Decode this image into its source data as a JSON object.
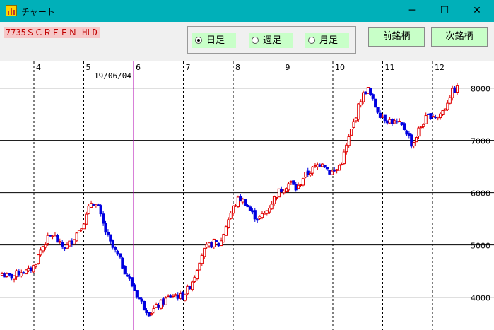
{
  "window": {
    "title": "チャート",
    "minimize": "─",
    "maximize": "☐",
    "close": "✕"
  },
  "stock": {
    "label": "7735ＳＣＲＥＥＮ HLD"
  },
  "period": {
    "options": [
      {
        "label": "日足",
        "selected": true
      },
      {
        "label": "週足",
        "selected": false
      },
      {
        "label": "月足",
        "selected": false
      }
    ]
  },
  "buttons": {
    "prev": "前銘柄",
    "next": "次銘柄"
  },
  "colors": {
    "titlebar": "#00b0b9",
    "up": "#e00000",
    "down": "#0000e0",
    "cursor": "#b000b0",
    "green_button": "#c8ffc8"
  },
  "chart_data": {
    "type": "candlestick",
    "y_ticks": [
      4000,
      5000,
      6000,
      7000,
      8000
    ],
    "y_tick_labels": [
      "4000",
      "5000",
      "6000",
      "7000",
      "8000"
    ],
    "x_month_labels": [
      "4",
      "5",
      "6",
      "7",
      "8",
      "9",
      "10",
      "11",
      "12"
    ],
    "cursor_date_label": "19/06/04",
    "ylim": [
      3400,
      8400
    ],
    "close_path": [
      4450,
      4380,
      4420,
      4500,
      4480,
      4600,
      4900,
      5100,
      5200,
      5000,
      4950,
      5100,
      5300,
      5500,
      5850,
      5700,
      5300,
      5000,
      4800,
      4550,
      4300,
      4050,
      3850,
      3700,
      3800,
      3900,
      4000,
      4050,
      4000,
      4150,
      4400,
      4800,
      4950,
      5050,
      5000,
      5400,
      5700,
      5900,
      5800,
      5600,
      5500,
      5600,
      5800,
      6000,
      6100,
      6200,
      6050,
      6300,
      6400,
      6500,
      6600,
      6400,
      6400,
      6600,
      7000,
      7400,
      7800,
      8000,
      7700,
      7500,
      7400,
      7350,
      7300,
      7200,
      6900,
      7200,
      7400,
      7500,
      7450,
      7600,
      7900,
      8000
    ]
  }
}
